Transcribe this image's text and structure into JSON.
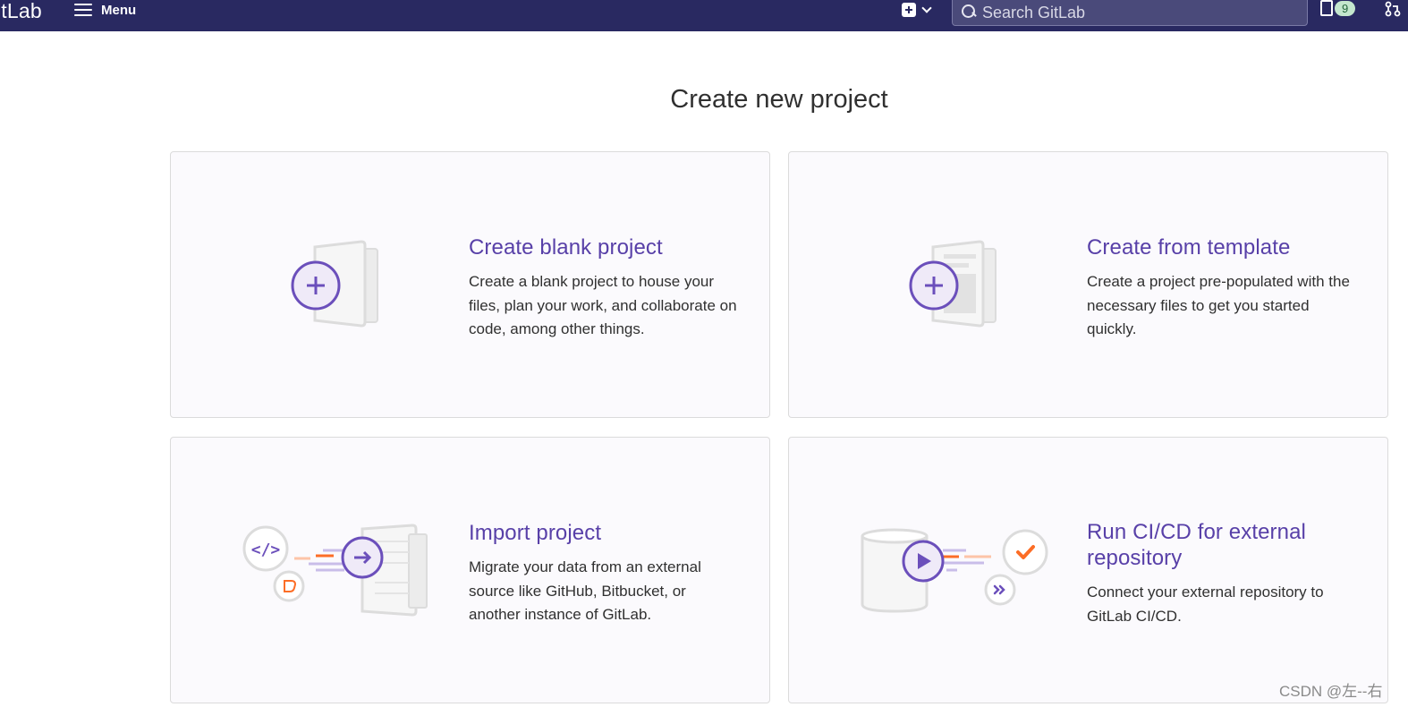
{
  "navbar": {
    "brand": "itLab",
    "menu_label": "Menu",
    "search_placeholder": "Search GitLab",
    "todo_count": "9"
  },
  "page": {
    "title": "Create new project"
  },
  "cards": [
    {
      "title": "Create blank project",
      "description": "Create a blank project to house your files, plan your work, and collaborate on code, among other things."
    },
    {
      "title": "Create from template",
      "description": "Create a project pre-populated with the necessary files to get you started quickly."
    },
    {
      "title": "Import project",
      "description": "Migrate your data from an external source like GitHub, Bitbucket, or another instance of GitLab."
    },
    {
      "title": "Run CI/CD for external repository",
      "description": "Connect your external repository to GitLab CI/CD."
    }
  ],
  "watermark": "CSDN @左--右",
  "colors": {
    "navbar": "#292961",
    "accent": "#6b4fbb",
    "card_title": "#5840a8",
    "orange": "#fc6d26"
  }
}
